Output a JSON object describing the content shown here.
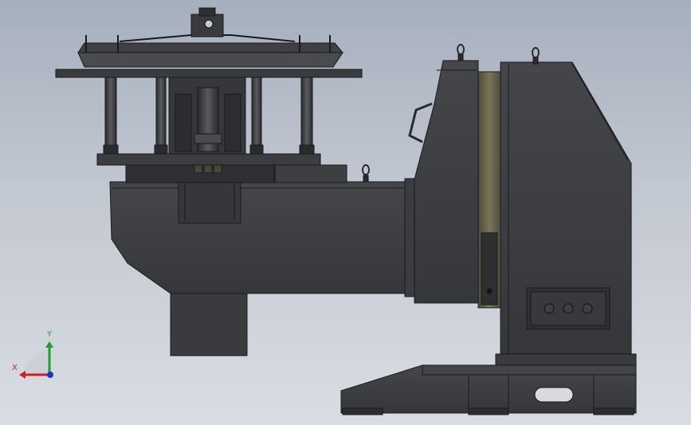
{
  "triad": {
    "x_label": "X",
    "y_label": "Y",
    "x_color": "#cc1f1f",
    "y_color": "#1f9e2a",
    "z_color": "#2033c6"
  },
  "model": {
    "body_color": "#3d3e41",
    "edge_color": "#1a1a1c",
    "faceplate_color": "#6e6a4e"
  }
}
